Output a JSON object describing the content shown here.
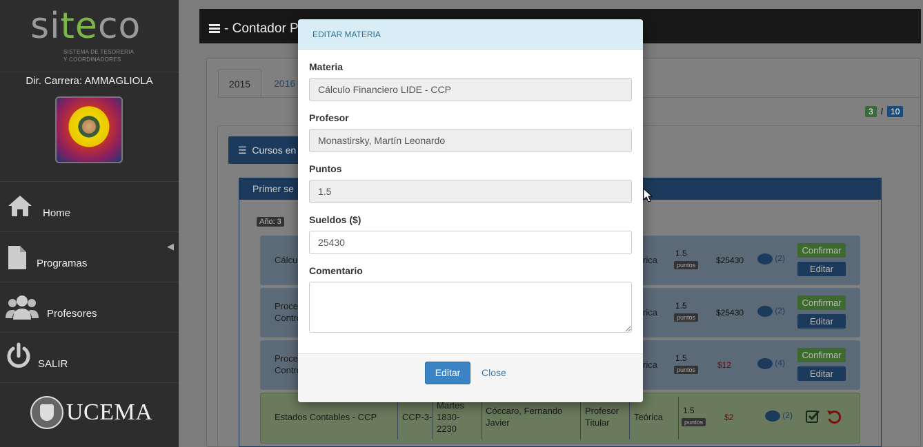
{
  "sidebar": {
    "logo_word_1": "si",
    "logo_word_2": "te",
    "logo_word_3": "co",
    "logo_subtitle_1": "SISTEMA DE TESORERIA",
    "logo_subtitle_2": "Y COORDINADORES",
    "director": "Dir. Carrera: AMMAGLIOLA",
    "menu": [
      {
        "label": "Home",
        "icon": "home-icon"
      },
      {
        "label": "Programas",
        "icon": "file-icon"
      },
      {
        "label": "Profesores",
        "icon": "users-icon"
      },
      {
        "label": "SALIR",
        "icon": "power-icon"
      }
    ],
    "footer_logo": "UCEMA"
  },
  "header": {
    "title": "- Contador P"
  },
  "tabs": [
    "2015",
    "2016"
  ],
  "badges": {
    "left": "3",
    "sep": "/",
    "right": "10",
    "left_color": "#5cb85c",
    "right_color": "#337ab7"
  },
  "section_button": "Cursos en",
  "semester_title": "Primer se",
  "year_badge": "Año: 3",
  "rows": [
    {
      "name": "Cálcul",
      "points": "1.5",
      "points_label": "puntos",
      "salary": "$25430",
      "comments": "(2)",
      "type": "rica",
      "confirm": "Confirmar",
      "edit": "Editar"
    },
    {
      "name_1": "Proce",
      "name_2": "Contro",
      "points": "1.5",
      "points_label": "puntos",
      "salary": "$25430",
      "comments": "(2)",
      "type": "rica",
      "confirm": "Confirmar",
      "edit": "Editar"
    },
    {
      "name_1": "Proce",
      "name_2": "Contro",
      "points": "1.5",
      "points_label": "puntos",
      "salary": "$12",
      "comments": "(4)",
      "type": "rica",
      "confirm": "Confirmar",
      "edit": "Editar"
    },
    {
      "name": "Estados Contables - CCP",
      "code": "CCP-3-",
      "schedule_1": "Martes",
      "schedule_2": "1830-",
      "schedule_3": "2230",
      "professor_1": "Cóccaro, Fernando",
      "professor_2": "Javier",
      "role_1": "Profesor",
      "role_2": "Titular",
      "type": "Teórica",
      "points": "1.5",
      "points_label": "puntos",
      "salary": "$2",
      "comments": "(2)"
    }
  ],
  "modal": {
    "title": "EDITAR MATERIA",
    "fields": [
      {
        "label": "Materia",
        "value": "Cálculo Financiero LIDE - CCP"
      },
      {
        "label": "Profesor",
        "value": "Monastirsky, Martín Leonardo"
      },
      {
        "label": "Puntos",
        "value": "1.5"
      },
      {
        "label": "Sueldos ($)",
        "value": "25430"
      },
      {
        "label": "Comentario",
        "value": ""
      }
    ],
    "submit": "Editar",
    "close": "Close"
  }
}
